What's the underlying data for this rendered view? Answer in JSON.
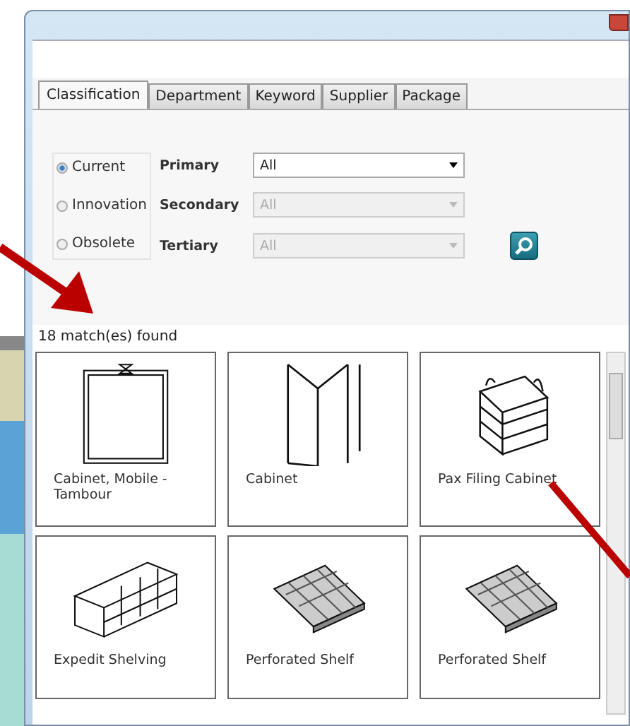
{
  "tabs": [
    {
      "label": "Classification",
      "selected": true
    },
    {
      "label": "Department",
      "selected": false
    },
    {
      "label": "Keyword",
      "selected": false
    },
    {
      "label": "Supplier",
      "selected": false
    },
    {
      "label": "Package",
      "selected": false
    }
  ],
  "status_options": [
    {
      "label": "Current",
      "selected": true
    },
    {
      "label": "Innovation",
      "selected": false
    },
    {
      "label": "Obsolete",
      "selected": false
    }
  ],
  "filters": [
    {
      "label": "Primary",
      "value": "All",
      "disabled": false
    },
    {
      "label": "Secondary",
      "value": "All",
      "disabled": true
    },
    {
      "label": "Tertiary",
      "value": "All",
      "disabled": true
    }
  ],
  "match_count": "18 match(es) found",
  "results": [
    {
      "name": "Cabinet, Mobile - Tambour",
      "kind": "cabinet"
    },
    {
      "name": "Cabinet",
      "kind": "panel"
    },
    {
      "name": "Pax Filing Cabinet",
      "kind": "filing"
    },
    {
      "name": "Expedit Shelving",
      "kind": "shelving"
    },
    {
      "name": "Perforated Shelf",
      "kind": "shelf"
    },
    {
      "name": "Perforated Shelf",
      "kind": "shelf"
    }
  ]
}
